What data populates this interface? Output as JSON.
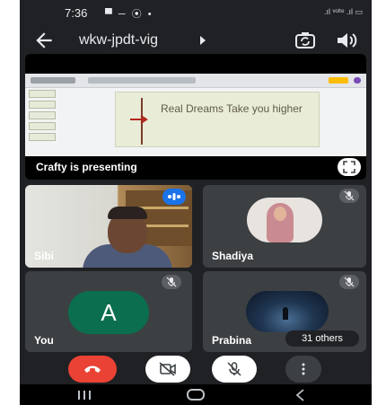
{
  "status_bar": {
    "time": "7:36",
    "notification_icons": "▀ ─ ⦿ •",
    "right_icons": ".ıl ᵛᵒˡᵗᵉ .ıl ▭"
  },
  "app_bar": {
    "back_icon": "arrow-left",
    "meeting_code": "wkw-jpdt-vig",
    "caret_icon": "caret-right",
    "camera_switch_icon": "camera-switch",
    "speaker_icon": "speaker"
  },
  "presentation": {
    "slide_text": "Real Dreams Take you higher",
    "presenter_label": "Crafty is presenting",
    "fullscreen_icon": "fullscreen"
  },
  "participants": [
    {
      "name": "Sibi",
      "muted": false,
      "speaking": true
    },
    {
      "name": "Shadiya",
      "muted": true
    },
    {
      "name": "You",
      "avatar_letter": "A",
      "muted": true,
      "avatar_color": "#0b6e4f"
    },
    {
      "name": "Prabina",
      "muted": true
    }
  ],
  "others_count_label": "31 others",
  "controls": {
    "end_call_icon": "end-call",
    "camera_icon": "camera-off",
    "mic_icon": "mic-off",
    "more_icon": "more-vertical",
    "end_call_color": "#ea4335"
  },
  "nav_bar": {
    "recents_icon": "recents",
    "home_icon": "home",
    "back_icon": "back"
  },
  "colors": {
    "background": "#202124",
    "tile": "#3c4043",
    "accent_blue": "#1a73e8"
  }
}
